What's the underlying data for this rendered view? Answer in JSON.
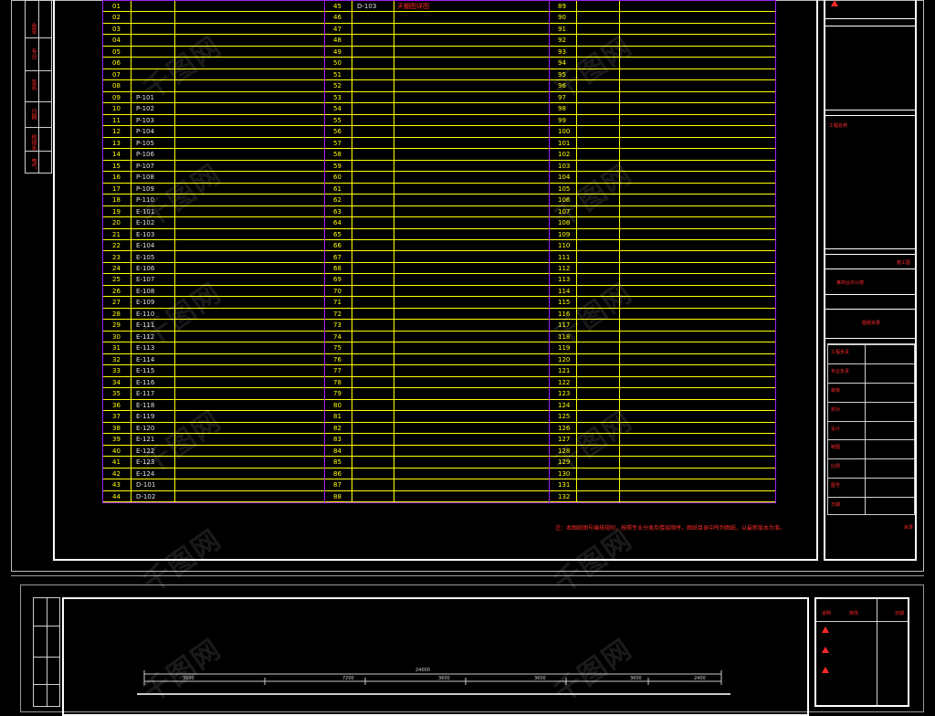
{
  "sheet": {
    "left_strip_labels": [
      "会签",
      "专业",
      "签名",
      "日期",
      "给排水",
      "电气"
    ],
    "row_numbers_col1": [
      "01",
      "02",
      "03",
      "04",
      "05",
      "06",
      "07",
      "08",
      "09",
      "10",
      "11",
      "12",
      "13",
      "14",
      "15",
      "16",
      "17",
      "18",
      "19",
      "20",
      "21",
      "22",
      "23",
      "24",
      "25",
      "26",
      "27",
      "28",
      "29",
      "30",
      "31",
      "32",
      "33",
      "34",
      "35",
      "36",
      "37",
      "38",
      "39",
      "40",
      "41",
      "42",
      "43",
      "44"
    ],
    "codes_col1": [
      "",
      "",
      "",
      "",
      "",
      "",
      "",
      "",
      "P-101",
      "P-102",
      "P-103",
      "P-104",
      "P-105",
      "P-106",
      "P-107",
      "P-108",
      "P-109",
      "P-110",
      "E-101",
      "E-102",
      "E-103",
      "E-104",
      "E-105",
      "E-106",
      "E-107",
      "E-108",
      "E-109",
      "E-110",
      "E-111",
      "E-112",
      "E-113",
      "E-114",
      "E-115",
      "E-116",
      "E-117",
      "E-118",
      "E-119",
      "E-120",
      "E-121",
      "E-122",
      "E-123",
      "E-124",
      "D-101",
      "D-102"
    ],
    "row_numbers_col2": [
      "45",
      "46",
      "47",
      "48",
      "49",
      "50",
      "51",
      "52",
      "53",
      "54",
      "55",
      "56",
      "57",
      "58",
      "59",
      "60",
      "61",
      "62",
      "63",
      "64",
      "65",
      "66",
      "67",
      "68",
      "69",
      "70",
      "71",
      "72",
      "73",
      "74",
      "75",
      "76",
      "77",
      "78",
      "79",
      "80",
      "81",
      "82",
      "83",
      "84",
      "85",
      "86",
      "87",
      "88"
    ],
    "row_numbers_col3": [
      "89",
      "90",
      "91",
      "92",
      "93",
      "94",
      "95",
      "96",
      "97",
      "98",
      "99",
      "100",
      "101",
      "102",
      "103",
      "104",
      "105",
      "106",
      "107",
      "108",
      "109",
      "110",
      "111",
      "112",
      "113",
      "114",
      "115",
      "116",
      "117",
      "118",
      "119",
      "120",
      "121",
      "122",
      "123",
      "124",
      "125",
      "126",
      "127",
      "128",
      "129",
      "130",
      "131",
      "132"
    ],
    "first_code_col2": "D-103",
    "first_desc_col2": "天棚图详图",
    "notes": "注：本图纸图号编排规则，按照专业分类及楼层顺序，图纸目录中所列图纸，以最新版本为准。"
  },
  "title_block": {
    "project_label": "工程名称",
    "drawing_title": "图纸目录",
    "drawing_name": "某商业办公楼",
    "stage": "施工图",
    "fields": [
      "工程负责",
      "专业负责",
      "审核",
      "校对",
      "设计",
      "制图",
      "比例",
      "图号",
      "日期"
    ],
    "page_label": "目录"
  },
  "lower_sheet": {
    "dim_labels": [
      "24000",
      "3600",
      "7200",
      "3600",
      "3600",
      "3600",
      "2400"
    ],
    "title_block_labels": [
      "说明",
      "修改",
      "日期"
    ]
  },
  "watermark_text": "千图网"
}
